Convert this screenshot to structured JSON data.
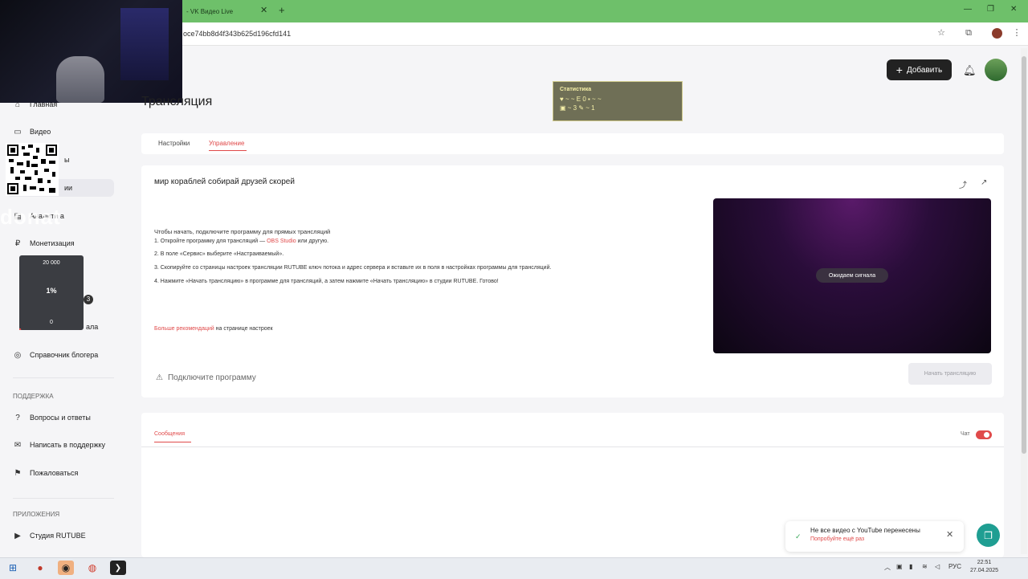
{
  "browser": {
    "tab_title": "- VK Видео Live",
    "tab_close": "✕",
    "tab_new": "+",
    "url": "oce74bb8d4f343b625d196cfd141",
    "win_min": "—",
    "win_max": "❐",
    "win_close": "✕"
  },
  "sidebar": {
    "items": [
      {
        "label": "Главная",
        "icon": "home-icon"
      },
      {
        "label": "Видео",
        "icon": "video-icon"
      },
      {
        "label": "Монетизация",
        "icon": "monetization-icon"
      },
      {
        "label": "Справочник блогера",
        "icon": "handbook-icon"
      }
    ],
    "partial": {
      "label1": "ы",
      "label2": "ии",
      "label3": "Аналити а",
      "label4": "ала"
    },
    "support_header": "ПОДДЕРЖКА",
    "support_items": [
      {
        "label": "Вопросы и ответы",
        "icon": "faq-icon"
      },
      {
        "label": "Написать в поддержку",
        "icon": "mail-icon"
      },
      {
        "label": "Пожаловаться",
        "icon": "flag-icon"
      }
    ],
    "apps_header": "ПРИЛОЖЕНИЯ",
    "apps_items": [
      {
        "label": "Студия RUTUBE",
        "icon": "studio-icon"
      }
    ]
  },
  "overlay": {
    "donat_text": "donat",
    "goal_top": "20 000",
    "goal_percent": "1%",
    "goal_bottom": "0",
    "goal_progress": 0.01,
    "goal_badge": "3"
  },
  "stats_widget": {
    "title": "Статистика",
    "row1": "♥ ~ ~ E 0 ▪ ~ ~",
    "row2": "▣ ~ 3 ✎ ~ 1"
  },
  "header": {
    "page_title": "Трансляция",
    "add_label": "Добавить"
  },
  "tabs": [
    {
      "label": "Настройки",
      "active": false
    },
    {
      "label": "Управление",
      "active": true
    }
  ],
  "stream": {
    "title": "мир кораблей собирай друзей скорей",
    "intro": "Чтобы начать, подключите программу для прямых трансляций",
    "step1_a": "1. Откройте программу для трансляций — ",
    "step1_link": "OBS Studio",
    "step1_b": " или другую.",
    "step2": "2. В поле «Сервис» выберите «Настраиваемый».",
    "step3": "3. Скопируйте со страницы настроек трансляции RUTUBE ключ потока и адрес сервера и вставьте их в поля в настройках программы для трансляций.",
    "step4": "4. Нажмите «Начать трансляцию» в программе для трансляций, а затем нажмите «Начать трансляцию» в студии RUTUBE. Готово!",
    "more_link": "Больше рекомендаций",
    "more_rest": " на странице настроек",
    "preview_status": "Ожидаем сигнала",
    "connect_label": "Подключите программу",
    "start_label": "Начать трансляцию"
  },
  "chat": {
    "messages_tab": "Сообщения",
    "chat_label": "Чат",
    "chat_enabled": true
  },
  "toast": {
    "title": "Не все видео с YouTube перенесены",
    "link": "Попробуйте ещё раз"
  },
  "taskbar": {
    "lang": "РУС",
    "time": "22:51",
    "date": "27.04.2025"
  },
  "colors": {
    "accent": "#e04a4a",
    "tabbar": "#6ec06a",
    "help": "#1f9e92"
  }
}
